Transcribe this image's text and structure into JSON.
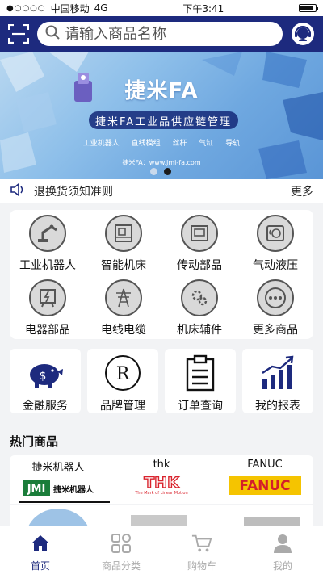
{
  "status_bar": {
    "carrier": "中国移动",
    "network": "4G",
    "time": "下午3:41",
    "battery_level": 0.85
  },
  "header": {
    "search_placeholder": "请输入商品名称"
  },
  "banner": {
    "title": "捷米FA",
    "slogan": "捷米FA工业品供应链管理",
    "tags": [
      "工业机器人",
      "直线模组",
      "丝杆",
      "气缸",
      "导轨"
    ],
    "url": "捷米FA：www.jmi-fa.com",
    "slide_count": 2,
    "active_slide": 2
  },
  "notice": {
    "text": "退换货须知准则",
    "more": "更多"
  },
  "categories": [
    {
      "label": "工业机器人",
      "icon": "robot-arm-icon"
    },
    {
      "label": "智能机床",
      "icon": "machine-tool-icon"
    },
    {
      "label": "传动部品",
      "icon": "transmission-icon"
    },
    {
      "label": "气动液压",
      "icon": "pneumatic-icon"
    },
    {
      "label": "电器部品",
      "icon": "electrical-icon"
    },
    {
      "label": "电线电缆",
      "icon": "cable-tower-icon"
    },
    {
      "label": "机床辅件",
      "icon": "gears-icon"
    },
    {
      "label": "更多商品",
      "icon": "more-dots-icon"
    }
  ],
  "services": [
    {
      "label": "金融服务",
      "icon": "piggy-bank-icon"
    },
    {
      "label": "品牌管理",
      "icon": "registered-icon"
    },
    {
      "label": "订单查询",
      "icon": "clipboard-icon"
    },
    {
      "label": "我的报表",
      "icon": "bar-chart-icon"
    }
  ],
  "hot": {
    "title": "热门商品",
    "brands": [
      {
        "name": "捷米机器人",
        "logo_text": "JMI",
        "logo_sub": "捷米机器人"
      },
      {
        "name": "thk",
        "logo_text": "THK",
        "logo_sub": "The Mark of Linear Motion"
      },
      {
        "name": "FANUC",
        "logo_text": "FANUC"
      }
    ],
    "active_brand": 0
  },
  "tabbar": [
    {
      "label": "首页",
      "icon": "home-icon",
      "active": true
    },
    {
      "label": "商品分类",
      "icon": "category-grid-icon",
      "active": false
    },
    {
      "label": "购物车",
      "icon": "cart-icon",
      "active": false
    },
    {
      "label": "我的",
      "icon": "profile-icon",
      "active": false
    }
  ],
  "colors": {
    "brand": "#1d2a7e",
    "thk_red": "#d9232d",
    "fanuc_yellow": "#f5c400",
    "fanuc_red": "#d41e2a"
  }
}
